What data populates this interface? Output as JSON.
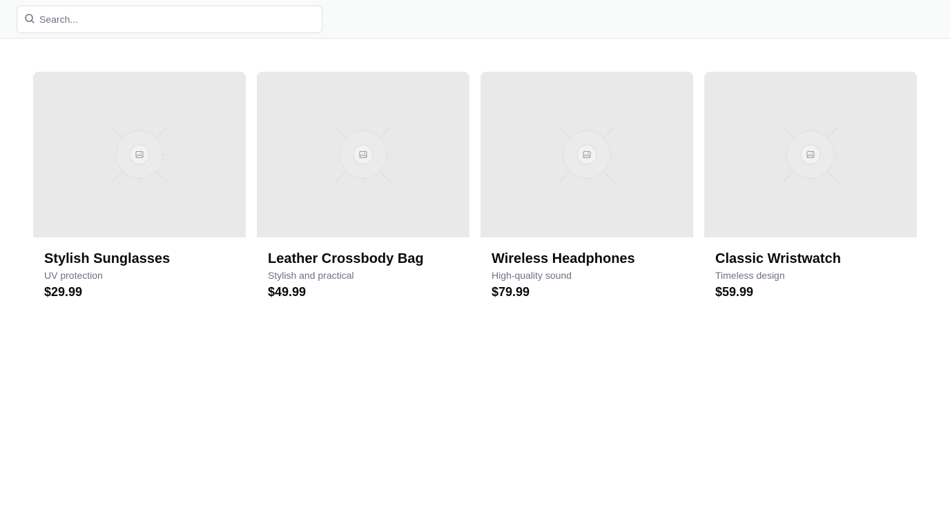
{
  "search": {
    "placeholder": "Search..."
  },
  "products": [
    {
      "title": "Stylish Sunglasses",
      "description": "UV protection",
      "price": "$29.99"
    },
    {
      "title": "Leather Crossbody Bag",
      "description": "Stylish and practical",
      "price": "$49.99"
    },
    {
      "title": "Wireless Headphones",
      "description": "High-quality sound",
      "price": "$79.99"
    },
    {
      "title": "Classic Wristwatch",
      "description": "Timeless design",
      "price": "$59.99"
    }
  ],
  "colors": {
    "topbar_bg": "#f9fafa",
    "image_placeholder_bg": "#e9e9e9",
    "muted_text": "#6b7280"
  },
  "icons": {
    "search": "search-icon",
    "image_placeholder": "image-placeholder-icon"
  }
}
